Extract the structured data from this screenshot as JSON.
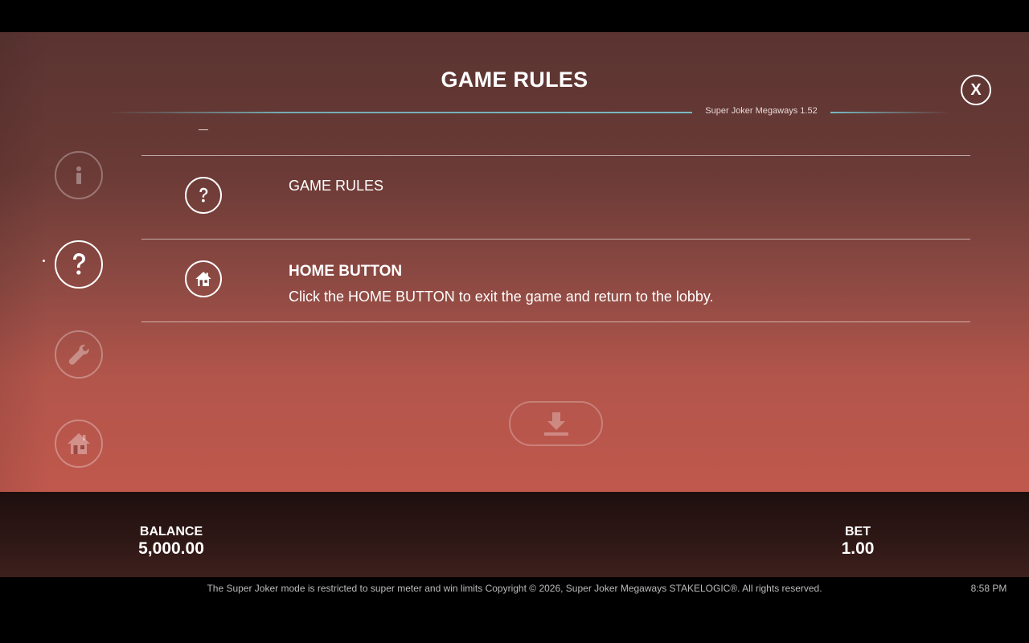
{
  "header": {
    "title": "GAME RULES",
    "close_label": "X",
    "version": "Super Joker Megaways 1.52"
  },
  "sidebar": {
    "items": [
      {
        "name": "info",
        "icon": "info-icon",
        "active": false
      },
      {
        "name": "game-rules",
        "icon": "question-icon",
        "active": true
      },
      {
        "name": "settings",
        "icon": "wrench-icon",
        "active": false
      },
      {
        "name": "home",
        "icon": "home-icon",
        "active": false
      }
    ]
  },
  "rules": {
    "rows": [
      {
        "icon": "question-icon",
        "title": "GAME RULES"
      },
      {
        "icon": "home-icon",
        "title": "HOME BUTTON",
        "description": "Click the HOME BUTTON to exit the game and return to the lobby."
      }
    ]
  },
  "download": {
    "icon": "download-icon"
  },
  "status": {
    "balance_label": "BALANCE",
    "balance_value": "5,000.00",
    "bet_label": "BET",
    "bet_value": "1.00"
  },
  "footer": {
    "text": "The Super Joker mode is restricted to super meter and win limits Copyright © 2026, Super Joker Megaways STAKELOGIC®. All rights reserved.",
    "time": "8:58 PM"
  },
  "colors": {
    "accent_line": "#78c8d2",
    "panel_top": "#5a3431",
    "panel_bottom": "#c0584d"
  }
}
